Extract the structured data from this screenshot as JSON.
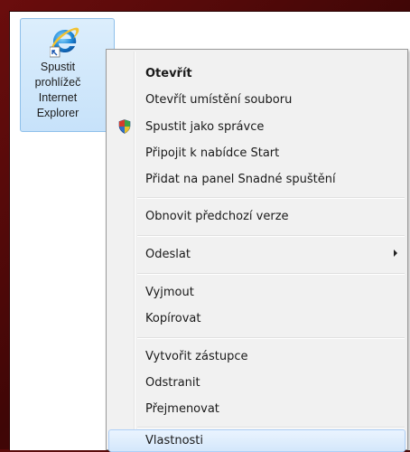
{
  "desktop_icon": {
    "label_lines": [
      "Spustit",
      "prohlížeč",
      "Internet",
      "Explorer"
    ],
    "icon": "internet-explorer-icon"
  },
  "context_menu": {
    "groups": [
      [
        {
          "label": "Otevřít",
          "bold": true
        },
        {
          "label": "Otevřít umístění souboru"
        },
        {
          "label": "Spustit jako správce",
          "icon": "uac-shield-icon"
        },
        {
          "label": "Připojit k nabídce Start"
        },
        {
          "label": "Přidat na panel Snadné spuštění"
        }
      ],
      [
        {
          "label": "Obnovit předchozí verze"
        }
      ],
      [
        {
          "label": "Odeslat",
          "submenu": true
        }
      ],
      [
        {
          "label": "Vyjmout"
        },
        {
          "label": "Kopírovat"
        }
      ],
      [
        {
          "label": "Vytvořit zástupce"
        },
        {
          "label": "Odstranit"
        },
        {
          "label": "Přejmenovat"
        }
      ],
      [
        {
          "label": "Vlastnosti",
          "highlighted": true
        }
      ]
    ]
  },
  "colors": {
    "frame": "#5a0b0b",
    "menu_background": "#f1f1f1",
    "highlight": "#d4e7fb",
    "icon_selection": "#c7e2fa"
  }
}
